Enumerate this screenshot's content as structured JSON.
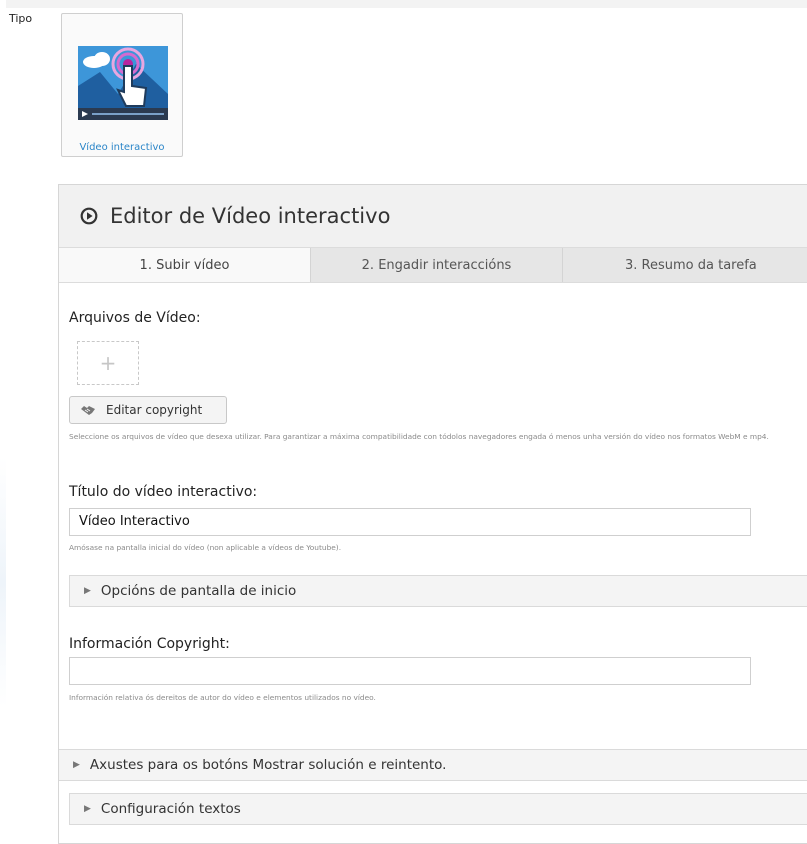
{
  "type_field": {
    "label": "Tipo",
    "selected_card": {
      "label": "Vídeo interactivo",
      "icon": "interactive-video-icon"
    }
  },
  "editor": {
    "title": "Editor de Vídeo interactivo",
    "tabs": [
      {
        "label": "1. Subir vídeo",
        "active": true
      },
      {
        "label": "2. Engadir interaccións",
        "active": false
      },
      {
        "label": "3. Resumo da tarefa",
        "active": false
      }
    ],
    "video_files": {
      "label": "Arquivos de Vídeo:",
      "add_symbol": "+",
      "copyright_button": "Editar copyright",
      "help": "Seleccione os arquivos de vídeo que desexa utilizar. Para garantizar a máxima compatibilidade con tódolos navegadores engada ó menos unha versión do vídeo nos formatos WebM e mp4."
    },
    "title_field": {
      "label": "Título do vídeo interactivo:",
      "value": "Vídeo Interactivo",
      "help": "Amósase na pantalla inicial do vídeo (non aplicable a vídeos de Youtube)."
    },
    "start_screen_options": {
      "label": "Opcións de pantalla de inicio"
    },
    "copyright_field": {
      "label": "Información Copyright:",
      "value": "",
      "help": "Información relativa ós dereitos de autor do vídeo e elementos utilizados no vídeo."
    },
    "buttons_settings": {
      "label": "Axustes para os botóns Mostrar solución e reintento."
    },
    "texts_config": {
      "label": "Configuración textos"
    }
  },
  "colors": {
    "accent_link": "#2a85c8",
    "header_bg": "#f1f1f1",
    "tab_bg": "#e6e6e6",
    "active_tab_bg": "#f9f9f9"
  }
}
